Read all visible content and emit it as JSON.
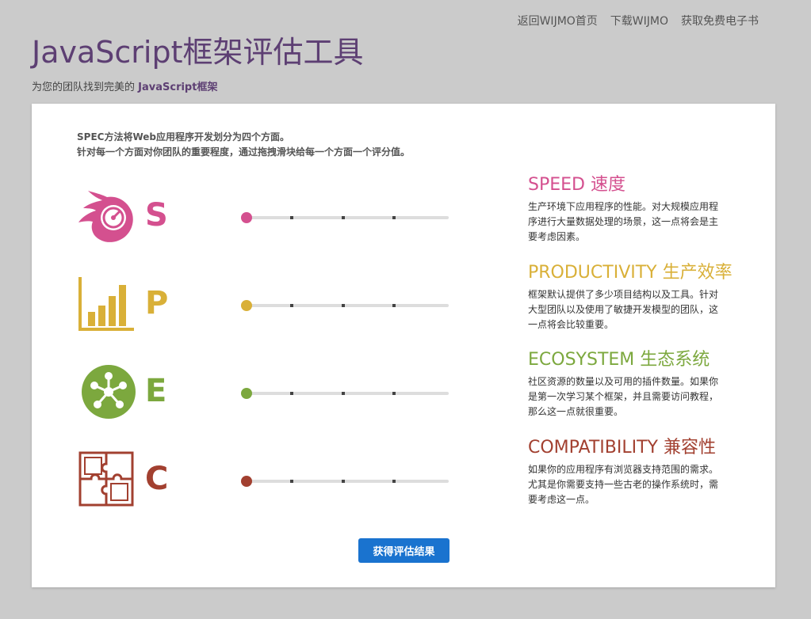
{
  "nav": {
    "home": "返回WIJMO首页",
    "download": "下载WIJMO",
    "ebook": "获取免费电子书"
  },
  "header": {
    "title": "JavaScript框架评估工具",
    "subtitle_prefix": "为您的团队找到完美的 ",
    "subtitle_bold": "JavaScript框架"
  },
  "intro": {
    "line1": "SPEC方法将Web应用程序开发划分为四个方面。",
    "line2": "针对每一个方面对你团队的重要程度，通过拖拽滑块给每一个方面一个评分值。"
  },
  "colors": {
    "speed": "#d4508f",
    "productivity": "#d9b038",
    "ecosystem": "#7ca83e",
    "compatibility": "#a24030"
  },
  "aspects": [
    {
      "letter": "S",
      "icon": "speedometer-flame-icon",
      "title": "SPEED 速度",
      "text": "生产环境下应用程序的性能。对大规模应用程序进行大量数据处理的场景，这一点将会是主要考虑因素。",
      "value": 0
    },
    {
      "letter": "P",
      "icon": "bar-chart-icon",
      "title": "PRODUCTIVITY 生产效率",
      "text": "框架默认提供了多少项目结构以及工具。针对大型团队以及使用了敏捷开发模型的团队，这一点将会比较重要。",
      "value": 0
    },
    {
      "letter": "E",
      "icon": "network-nodes-icon",
      "title": "ECOSYSTEM 生态系统",
      "text": "社区资源的数量以及可用的插件数量。如果你是第一次学习某个框架，并且需要访问教程，那么这一点就很重要。",
      "value": 0
    },
    {
      "letter": "C",
      "icon": "puzzle-icon",
      "title": "COMPATIBILITY 兼容性",
      "text": "如果你的应用程序有浏览器支持范围的需求。尤其是你需要支持一些古老的操作系统时，需要考虑这一点。",
      "value": 0
    }
  ],
  "slider": {
    "min": 0,
    "max": 4
  },
  "submit": {
    "label": "获得评估结果"
  }
}
